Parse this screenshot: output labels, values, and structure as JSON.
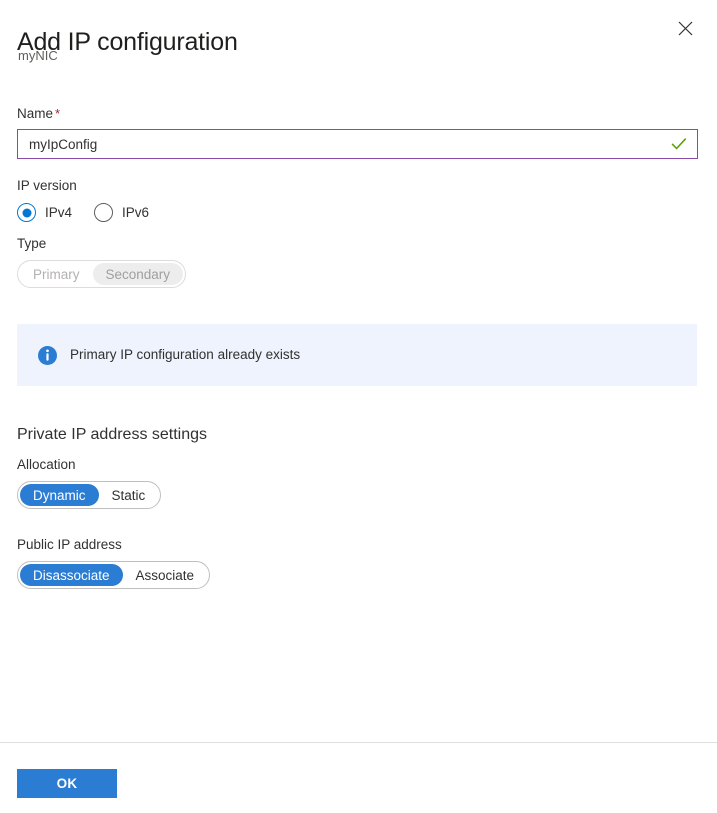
{
  "header": {
    "title": "Add IP configuration",
    "subtitle": "myNIC",
    "close_icon": "close-icon",
    "close_label": "Close"
  },
  "form": {
    "name": {
      "label": "Name",
      "required_marker": "*",
      "value": "myIpConfig",
      "placeholder": "",
      "validation_icon": "checkmark-icon",
      "border_color": "#8c4aa8",
      "valid_color": "#5ba300"
    },
    "ip_version": {
      "label": "IP version",
      "selected": "IPv4",
      "options": [
        {
          "label": "IPv4",
          "selected": true
        },
        {
          "label": "IPv6",
          "selected": false
        }
      ]
    },
    "type": {
      "label": "Type",
      "disabled": true,
      "selected": "Secondary",
      "options": [
        {
          "label": "Primary",
          "selected": false
        },
        {
          "label": "Secondary",
          "selected": true
        }
      ]
    },
    "info_banner": {
      "icon": "info-icon",
      "message": "Primary IP configuration already exists",
      "background": "#eff3fd",
      "icon_color": "#2b7cd3"
    },
    "private_ip": {
      "heading": "Private IP address settings",
      "allocation": {
        "label": "Allocation",
        "selected": "Dynamic",
        "options": [
          {
            "label": "Dynamic",
            "selected": true
          },
          {
            "label": "Static",
            "selected": false
          }
        ]
      }
    },
    "public_ip": {
      "label": "Public IP address",
      "selected": "Disassociate",
      "options": [
        {
          "label": "Disassociate",
          "selected": true
        },
        {
          "label": "Associate",
          "selected": false
        }
      ]
    }
  },
  "footer": {
    "ok_label": "OK",
    "accent_color": "#2b7cd3"
  }
}
